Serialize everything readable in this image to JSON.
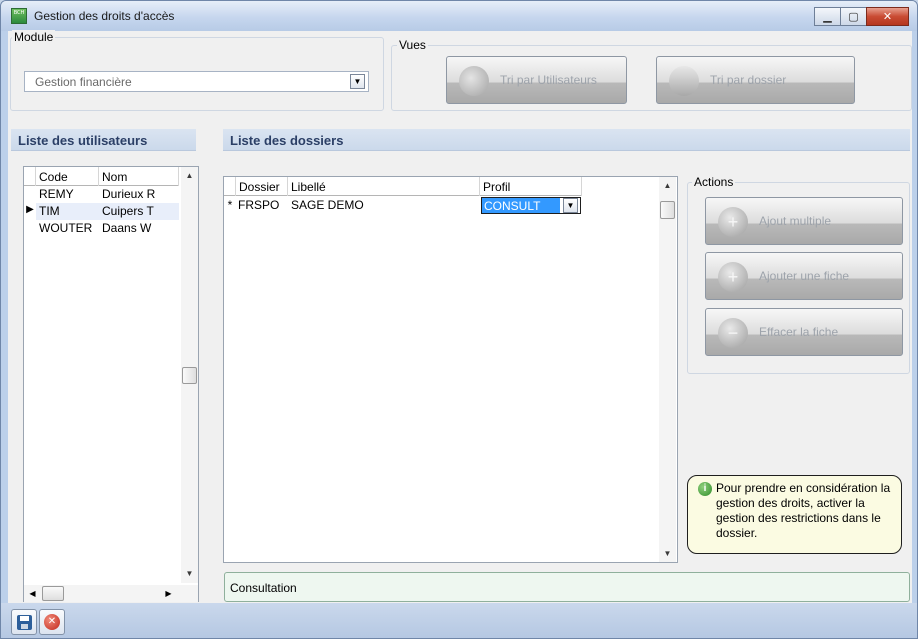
{
  "window": {
    "title": "Gestion des droits d'accès",
    "app_icon_text": "BCH",
    "minimize_glyph": "▁",
    "maximize_glyph": "▢",
    "close_glyph": "✕"
  },
  "module": {
    "label": "Module",
    "selected": "Gestion financière",
    "dropdown_glyph": "▼"
  },
  "vues": {
    "label": "Vues",
    "btn_users": "Tri par Utilisateurs",
    "btn_dossier": "Tri par dossier"
  },
  "users": {
    "header": "Liste des utilisateurs",
    "columns": [
      "Code",
      "Nom"
    ],
    "rows": [
      {
        "code": "REMY",
        "nom": "Durieux R",
        "marker": ""
      },
      {
        "code": "TIM",
        "nom": "Cuipers T",
        "marker": "▶"
      },
      {
        "code": "WOUTER",
        "nom": "Daans W",
        "marker": ""
      }
    ]
  },
  "dossiers": {
    "header": "Liste des dossiers",
    "columns": [
      "Dossier",
      "Libellé",
      "Profil"
    ],
    "new_row": {
      "marker": "*",
      "dossier": "FRSPO",
      "libelle": "SAGE DEMO",
      "profil": "CONSULT"
    }
  },
  "actions": {
    "label": "Actions",
    "ajout_multiple": "Ajout multiple",
    "ajouter_fiche": "Ajouter une fiche",
    "effacer_fiche": "Effacer la fiche"
  },
  "info": {
    "icon_glyph": "i",
    "text": "Pour prendre en considération la gestion des droits, activer la gestion des restrictions dans le dossier."
  },
  "status": {
    "text": "Consultation"
  },
  "scroll": {
    "up": "▲",
    "down": "▼",
    "left": "◀",
    "right": "▶"
  },
  "colors": {
    "selection": "#3399ff",
    "section_header_text": "#2b3f66",
    "window_frame": "#bcd0ea"
  }
}
